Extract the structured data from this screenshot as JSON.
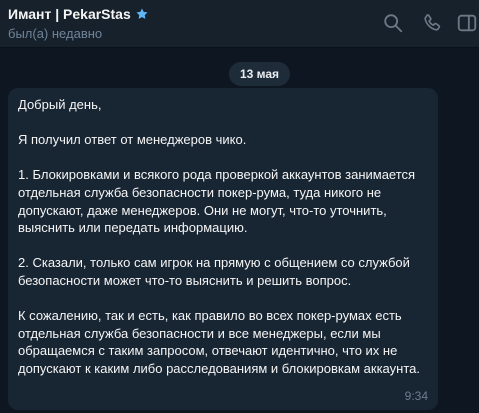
{
  "header": {
    "title": "Имант | PekarStas",
    "status": "был(а) недавно",
    "icons": [
      "verified-star-icon",
      "search-icon",
      "phone-icon",
      "sidebar-toggle-icon"
    ]
  },
  "date_separator": "13 мая",
  "message": {
    "paragraphs": [
      "Добрый день,",
      "Я получил ответ от менеджеров чико.",
      "1. Блокировками и всякого рода проверкой аккаунтов занимается отдельная служба безопасности покер-рума, туда никого не допускают, даже менеджеров. Они не могут, что-то уточнить, выяснить или передать информацию.",
      "2. Сказали, только сам игрок на прямую с общением со службой безопасности может что-то выяснить и решить вопрос.",
      "К сожалению, так и есть, как правило во всех покер-румах есть отдельная служба безопасности и все менеджеры, если мы обращаемся с таким запросом, отвечают идентично, что их не допускают к каким либо расследованиям и блокировкам аккаунта."
    ],
    "time": "9:34"
  },
  "colors": {
    "background": "#0e1621",
    "header": "#17212b",
    "bubble": "#182533",
    "accent_star": "#5eb5f7",
    "muted_text": "#708499"
  }
}
